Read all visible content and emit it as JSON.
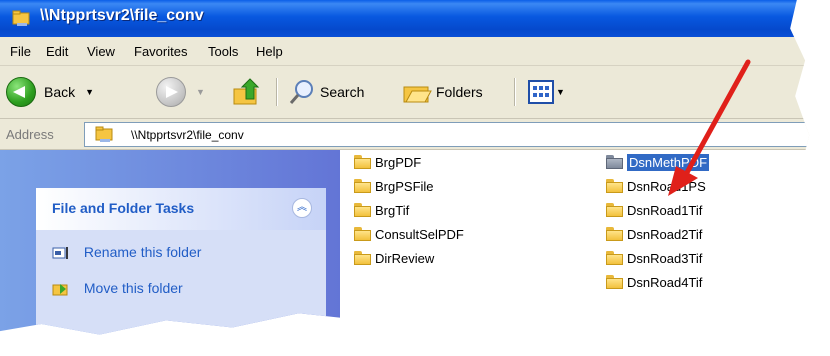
{
  "window": {
    "title": "\\\\Ntpprtsvr2\\file_conv"
  },
  "menu": [
    "File",
    "Edit",
    "View",
    "Favorites",
    "Tools",
    "Help"
  ],
  "toolbar": {
    "back_label": "Back",
    "search_label": "Search",
    "folders_label": "Folders"
  },
  "address": {
    "label": "Address",
    "value": "\\\\Ntpprtsvr2\\file_conv"
  },
  "tasks": {
    "title": "File and Folder Tasks",
    "items": [
      "Rename this folder",
      "Move this folder"
    ]
  },
  "files": {
    "col1": [
      "BrgPDF",
      "BrgPSFile",
      "BrgTif",
      "ConsultSelPDF",
      "DirReview"
    ],
    "col2": [
      "DsnMethPDF",
      "DsnRoad1PS",
      "DsnRoad1Tif",
      "DsnRoad2Tif",
      "DsnRoad3Tif",
      "DsnRoad4Tif"
    ]
  },
  "colors": {
    "accent": "#0a58e0",
    "selection": "#316ac5",
    "annotation_arrow": "#e0201a"
  }
}
